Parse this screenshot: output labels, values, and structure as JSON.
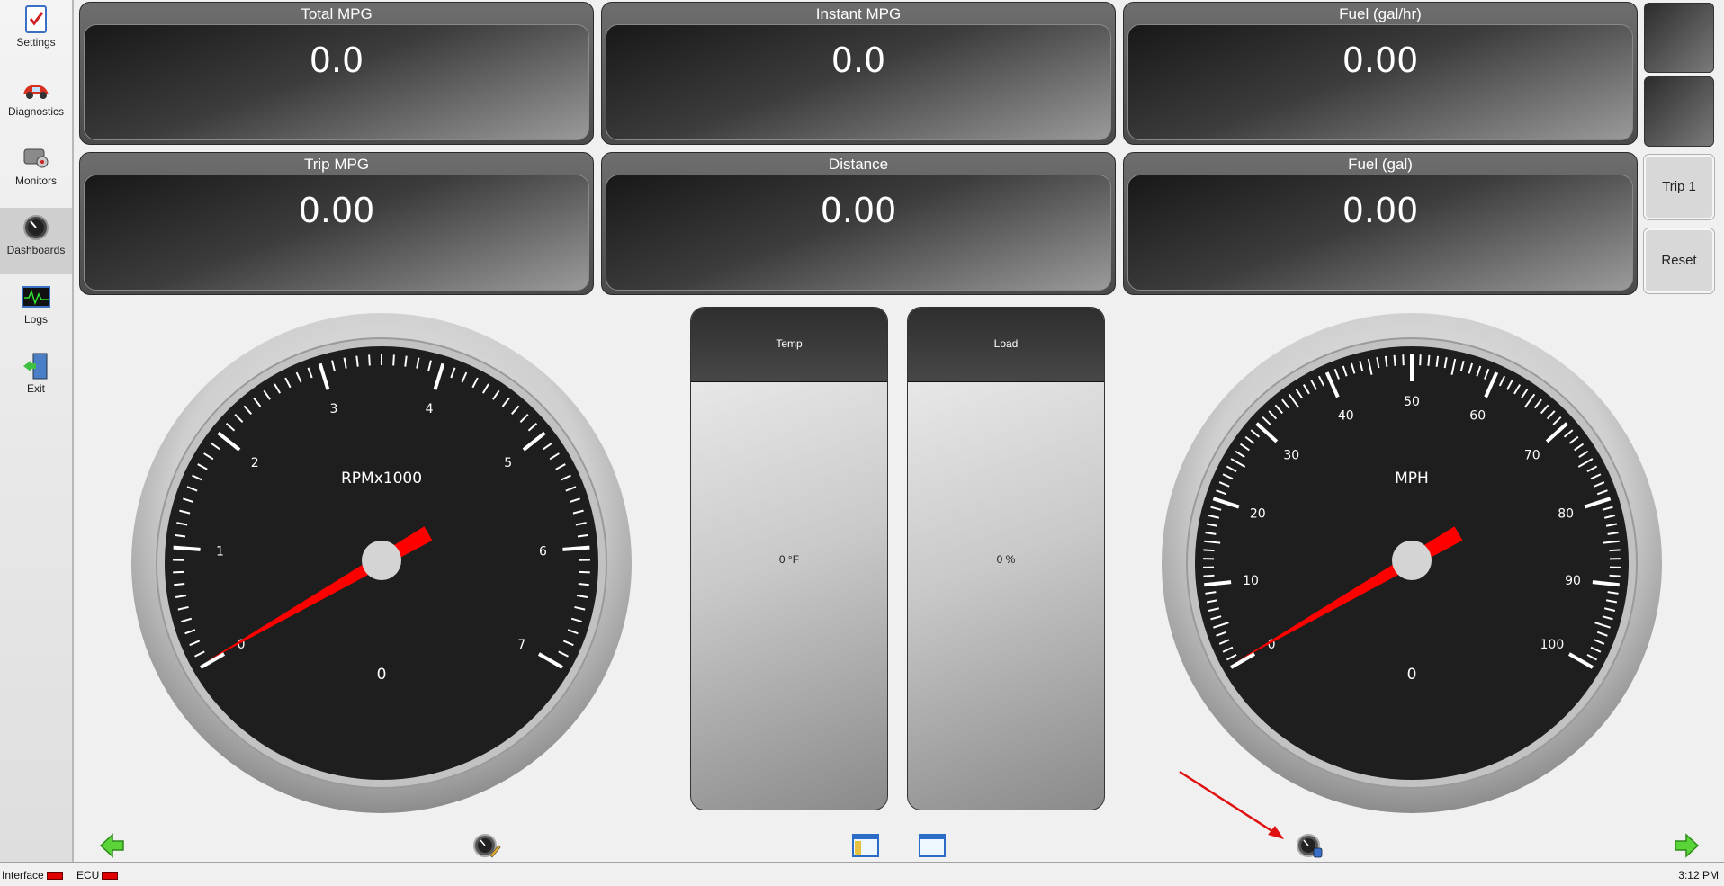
{
  "sidebar": {
    "items": [
      {
        "label": "Settings",
        "icon": "settings-icon"
      },
      {
        "label": "Diagnostics",
        "icon": "car-icon"
      },
      {
        "label": "Monitors",
        "icon": "monitors-icon"
      },
      {
        "label": "Dashboards",
        "icon": "gauge-icon"
      },
      {
        "label": "Logs",
        "icon": "waveform-icon"
      },
      {
        "label": "Exit",
        "icon": "exit-door-icon"
      }
    ],
    "active": "Dashboards"
  },
  "panels": [
    {
      "title": "Total MPG",
      "value": "0.0"
    },
    {
      "title": "Instant MPG",
      "value": "0.0"
    },
    {
      "title": "Fuel (gal/hr)",
      "value": "0.00"
    },
    {
      "title": "Trip MPG",
      "value": "0.00"
    },
    {
      "title": "Distance",
      "value": "0.00"
    },
    {
      "title": "Fuel (gal)",
      "value": "0.00"
    }
  ],
  "right_buttons": {
    "trip": "Trip 1",
    "reset": "Reset"
  },
  "bars": [
    {
      "title": "Temp",
      "value": "0 °F"
    },
    {
      "title": "Load",
      "value": "0 %"
    }
  ],
  "gauges": {
    "rpm": {
      "title": "RPMx1000",
      "value": "0",
      "reading": 0,
      "labels": [
        "0",
        "1",
        "2",
        "3",
        "4",
        "5",
        "6",
        "7"
      ],
      "redline_from": 7
    },
    "speed": {
      "title": "MPH",
      "value": "0",
      "reading": 0,
      "labels": [
        "0",
        "10",
        "20",
        "30",
        "40",
        "50",
        "60",
        "70",
        "80",
        "90",
        "100"
      ]
    }
  },
  "status": {
    "interface": "Interface",
    "ecu": "ECU",
    "time": "3:12 PM",
    "led_color": "#e00000"
  },
  "colors": {
    "needle": "#ff0000",
    "accent_arrow": "#33cc33"
  }
}
